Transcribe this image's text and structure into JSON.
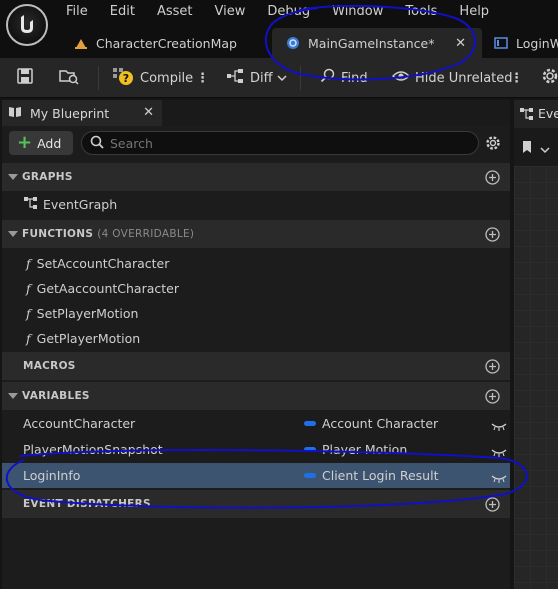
{
  "menu": {
    "items": [
      "File",
      "Edit",
      "Asset",
      "View",
      "Debug",
      "Window",
      "Tools",
      "Help"
    ]
  },
  "tabs": [
    {
      "label": "CharacterCreationMap",
      "icon": "level-icon"
    },
    {
      "label": "MainGameInstance*",
      "icon": "blueprint-icon"
    },
    {
      "label": "LoginW",
      "icon": "widget-icon"
    }
  ],
  "toolbar": {
    "compile_label": "Compile",
    "diff_label": "Diff",
    "find_label": "Find",
    "hide_unrelated_label": "Hide Unrelated"
  },
  "panel": {
    "title": "My Blueprint",
    "add_label": "Add",
    "search_placeholder": "Search"
  },
  "sections": {
    "graphs": {
      "label": "GRAPHS",
      "items": [
        "EventGraph"
      ]
    },
    "functions": {
      "label": "FUNCTIONS",
      "sub": "(4 OVERRIDABLE)",
      "items": [
        "SetAccountCharacter",
        "GetAaccountCharacter",
        "SetPlayerMotion",
        "GetPlayerMotion"
      ]
    },
    "macros": {
      "label": "MACROS"
    },
    "variables": {
      "label": "VARIABLES",
      "items": [
        {
          "name": "AccountCharacter",
          "type": "Account Character"
        },
        {
          "name": "PlayerMotionSnapshot",
          "type": "Player Motion"
        },
        {
          "name": "LoginInfo",
          "type": "Client Login Result",
          "selected": true
        }
      ]
    },
    "dispatchers": {
      "label": "EVENT DISPATCHERS"
    }
  },
  "graph_tab": {
    "label": "Eve"
  },
  "colors": {
    "selected_row": "#3d5470",
    "struct_pill": "#1f6fe8",
    "add_plus": "#59c25a",
    "annotation": "#1010c8"
  }
}
